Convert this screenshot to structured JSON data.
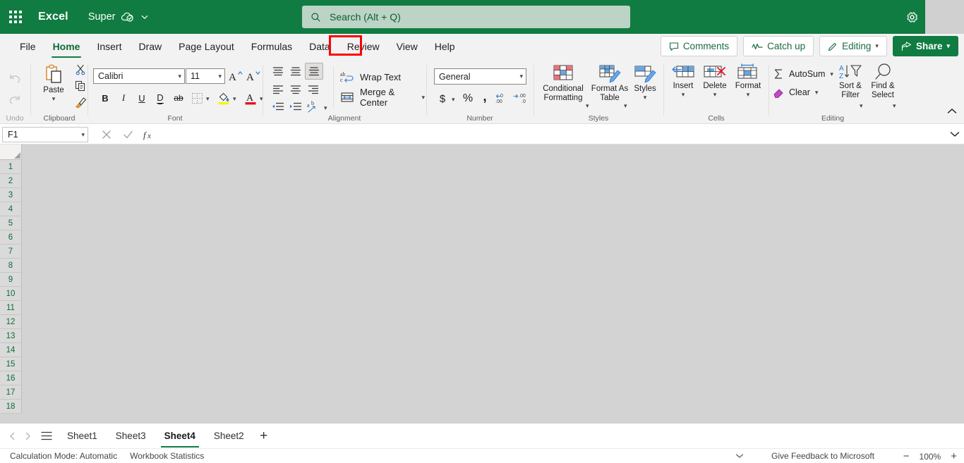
{
  "titlebar": {
    "waffle_name": "app-launcher",
    "app_name": "Excel",
    "doc_name": "Super",
    "cloud_status_icon": "cloud-saved-icon",
    "doc_menu_icon": "chevron-down-icon",
    "settings_icon": "gear-icon"
  },
  "search": {
    "placeholder": "Search (Alt + Q)",
    "icon": "search-icon"
  },
  "tabs": [
    {
      "label": "File",
      "active": false
    },
    {
      "label": "Home",
      "active": true
    },
    {
      "label": "Insert",
      "active": false
    },
    {
      "label": "Draw",
      "active": false
    },
    {
      "label": "Page Layout",
      "active": false
    },
    {
      "label": "Formulas",
      "active": false
    },
    {
      "label": "Data",
      "active": false,
      "highlighted": true
    },
    {
      "label": "Review",
      "active": false
    },
    {
      "label": "View",
      "active": false
    },
    {
      "label": "Help",
      "active": false
    }
  ],
  "header_actions": {
    "comments": "Comments",
    "catch_up": "Catch up",
    "editing": "Editing",
    "share": "Share"
  },
  "ribbon": {
    "collapse_icon": "chevron-up-icon",
    "undo": {
      "group_label": "Undo",
      "undo_icon": "undo-arrow-icon",
      "redo_icon": "redo-arrow-icon"
    },
    "clipboard": {
      "group_label": "Clipboard",
      "paste_label": "Paste",
      "cut_icon": "scissors-icon",
      "copy_icon": "copy-icon",
      "format_painter_icon": "format-painter-icon"
    },
    "font": {
      "group_label": "Font",
      "font_name": "Calibri",
      "font_size": "11",
      "grow_font": "A",
      "shrink_font": "A",
      "bold": "B",
      "italic": "I",
      "underline": "U",
      "double_underline": "D",
      "strikethrough": "ab",
      "borders_icon": "borders-icon",
      "fill_color_icon": "fill-color-icon",
      "font_color_letter": "A"
    },
    "alignment": {
      "group_label": "Alignment",
      "wrap_text": "Wrap Text",
      "merge_center": "Merge & Center"
    },
    "number": {
      "group_label": "Number",
      "format": "General",
      "currency": "$",
      "percent": "%",
      "comma": ",",
      "increase_decimal_icon": "increase-decimal-icon",
      "decrease_decimal_icon": "decrease-decimal-icon"
    },
    "styles": {
      "group_label": "Styles",
      "conditional_formatting": "Conditional Formatting",
      "format_as_table": "Format As Table",
      "cell_styles": "Styles"
    },
    "cells": {
      "group_label": "Cells",
      "insert": "Insert",
      "delete": "Delete",
      "format": "Format"
    },
    "editing": {
      "group_label": "Editing",
      "autosum": "AutoSum",
      "clear": "Clear",
      "sort_filter": "Sort & Filter",
      "find_select": "Find & Select"
    }
  },
  "formula_bar": {
    "name_box": "F1",
    "cancel_icon": "cancel-x-icon",
    "enter_icon": "checkmark-icon",
    "function_icon": "fx-icon",
    "formula_value": "",
    "expand_icon": "chevron-down-icon"
  },
  "grid": {
    "rows": [
      "1",
      "2",
      "3",
      "4",
      "5",
      "6",
      "7",
      "8",
      "9",
      "10",
      "11",
      "12",
      "13",
      "14",
      "15",
      "16",
      "17",
      "18"
    ],
    "select_all_name": "select-all-corner"
  },
  "sheet_bar": {
    "prev_icon": "chevron-left-icon",
    "next_icon": "chevron-right-icon",
    "all_sheets_icon": "hamburger-icon",
    "sheets": [
      {
        "label": "Sheet1",
        "active": false
      },
      {
        "label": "Sheet3",
        "active": false
      },
      {
        "label": "Sheet4",
        "active": true
      },
      {
        "label": "Sheet2",
        "active": false
      }
    ],
    "add_sheet": "+"
  },
  "status_bar": {
    "calculation_mode": "Calculation Mode: Automatic",
    "workbook_statistics": "Workbook Statistics",
    "more_icon": "chevron-down-icon",
    "feedback": "Give Feedback to Microsoft",
    "zoom_out": "−",
    "zoom_level": "100%",
    "zoom_in": "+"
  },
  "colors": {
    "brand_green": "#107C41",
    "highlight_red": "#FF0000",
    "search_bg": "#BCD4C5",
    "ribbon_bg": "#F2F2F2",
    "grid_disabled": "#D3D3D3",
    "row_header_text": "#0E6B37"
  }
}
